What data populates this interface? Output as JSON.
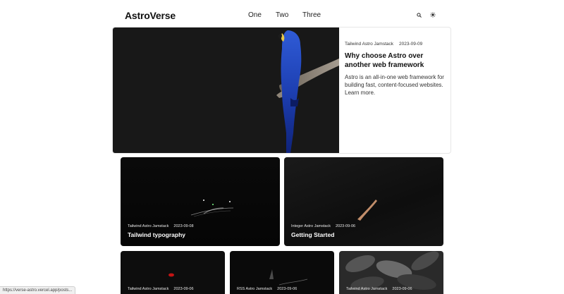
{
  "header": {
    "logo": "AstroVerse",
    "nav": [
      "One",
      "Two",
      "Three"
    ],
    "search_icon": "search-icon",
    "theme_icon": "sun-icon"
  },
  "hero": {
    "tags": "Tailwind Astro Jamstack",
    "date": "2023-09-09",
    "title": "Why choose Astro over another web framework",
    "description": "Astro is an all-in-one web framework for building fast, content-focused websites. Learn more."
  },
  "cards": [
    {
      "tags": "Tailwind Astro Jamstack",
      "date": "2023-09-08",
      "title": "Tailwind typography"
    },
    {
      "tags": "Integer Astro Jamstack",
      "date": "2023-09-06",
      "title": "Getting Started"
    },
    {
      "tags": "Tailwind Astro Jamstack",
      "date": "2023-09-06",
      "title": ""
    },
    {
      "tags": "RSS Astro Jamstack",
      "date": "2023-09-06",
      "title": ""
    },
    {
      "tags": "Tailwind Astro Jamstack",
      "date": "2023-09-06",
      "title": ""
    }
  ],
  "status_bar": "https://verse-astro.vercel.app/posts..."
}
